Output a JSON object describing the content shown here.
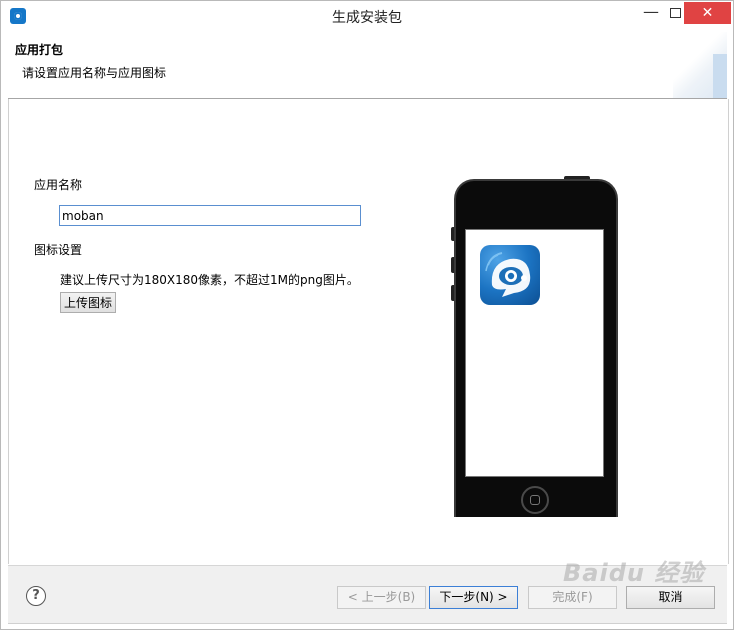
{
  "window": {
    "title": "生成安装包",
    "minimize": "—",
    "close": "✕"
  },
  "banner": {
    "title": "应用打包",
    "description": "请设置应用名称与应用图标"
  },
  "form": {
    "app_name_label": "应用名称",
    "app_name_value": "moban",
    "icon_settings_label": "图标设置",
    "icon_hint": "建议上传尺寸为180X180像素，不超过1M的png图片。",
    "upload_button": "上传图标"
  },
  "footer": {
    "help": "?",
    "back_button": "< 上一步(B)",
    "next_button": "下一步(N) >",
    "finish_button": "完成(F)",
    "cancel_button": "取消"
  },
  "watermark": "Baidu 经验",
  "colors": {
    "close_button": "#e04343",
    "input_border": "#5a8fd0",
    "icon_blue": "#1c74c3"
  }
}
